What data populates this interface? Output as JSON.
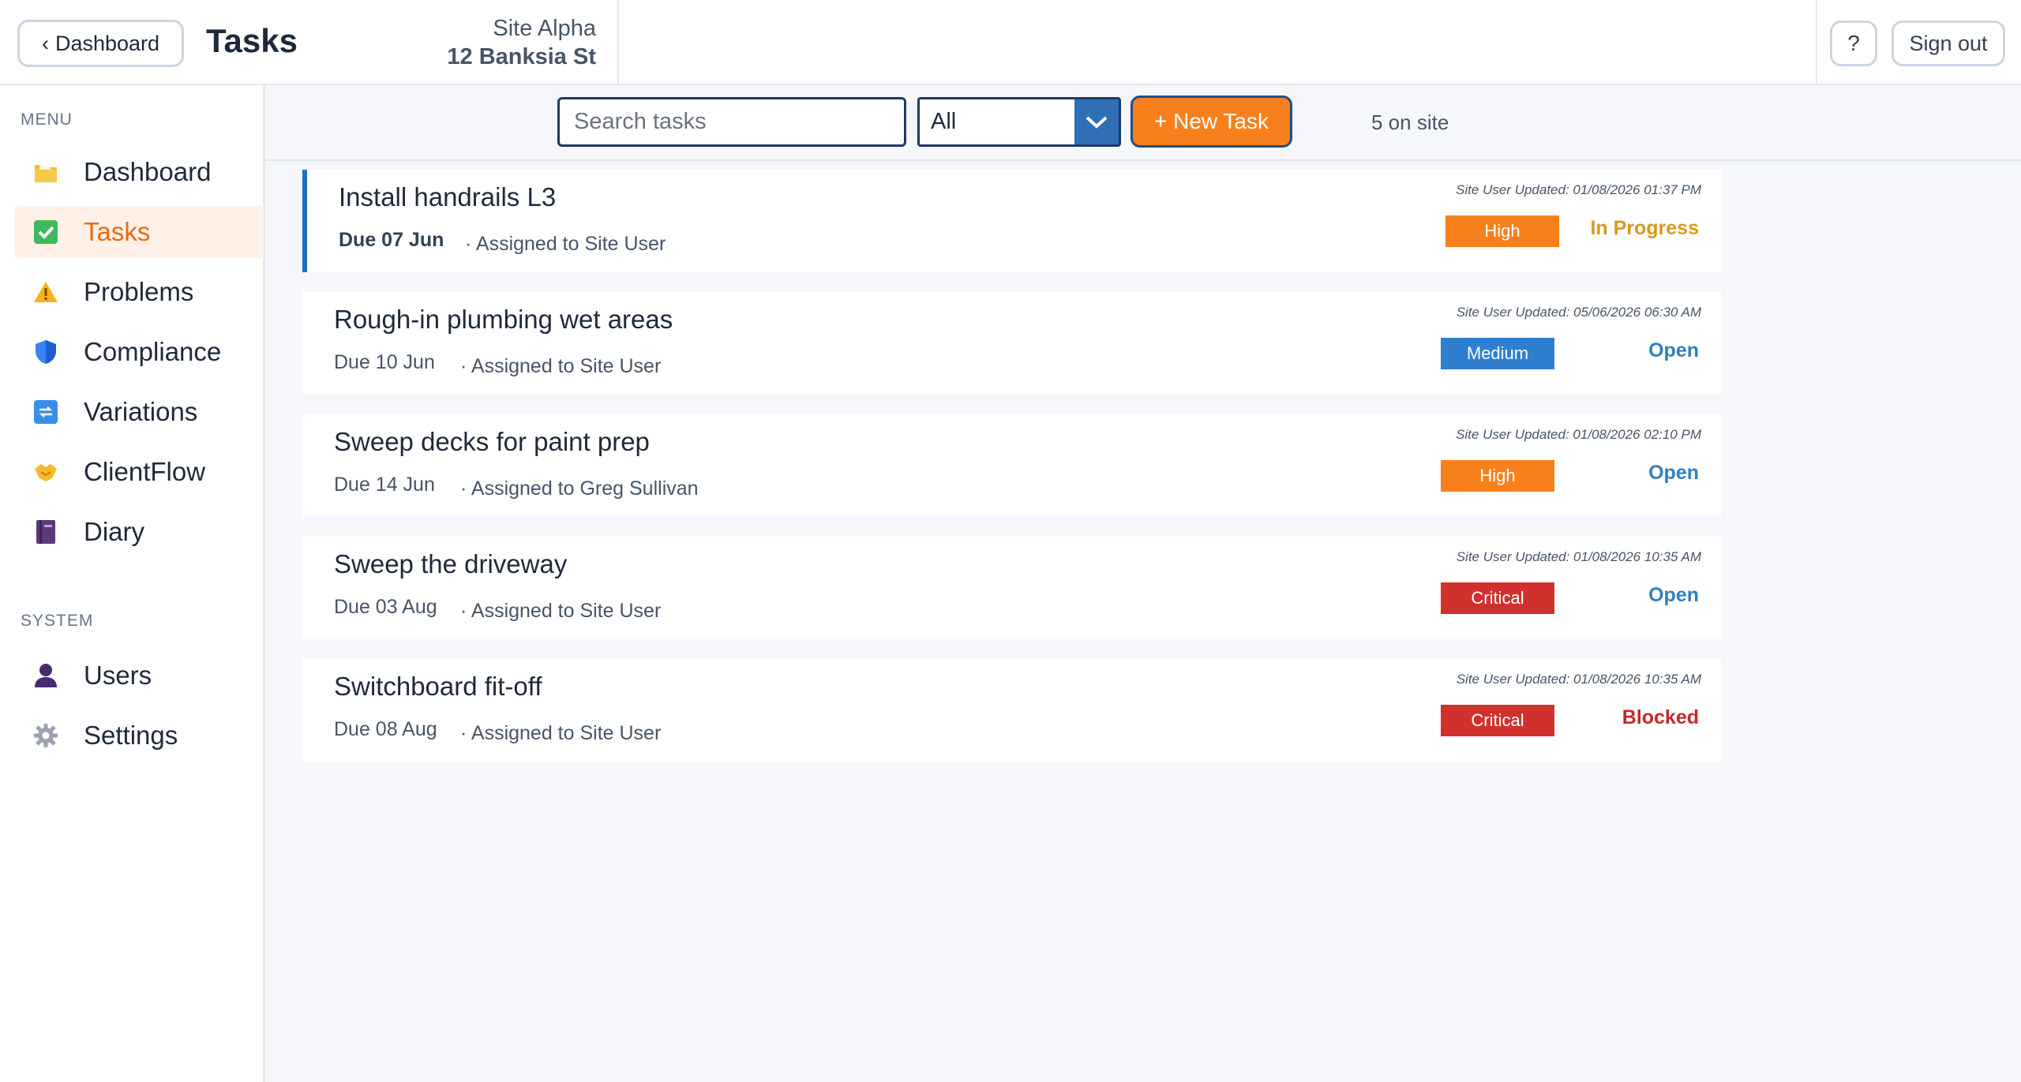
{
  "header": {
    "back_label": "Dashboard",
    "title": "Tasks",
    "site_name": "Site Alpha",
    "site_address": "12 Banksia St",
    "help_label": "?",
    "signout_label": "Sign out"
  },
  "sidebar": {
    "menu_label": "MENU",
    "system_label": "SYSTEM",
    "menu_items": [
      {
        "label": "Dashboard",
        "icon": "folder-icon"
      },
      {
        "label": "Tasks",
        "icon": "checkbox-icon",
        "active": true
      },
      {
        "label": "Problems",
        "icon": "warning-icon"
      },
      {
        "label": "Compliance",
        "icon": "shield-icon"
      },
      {
        "label": "Variations",
        "icon": "repeat-icon"
      },
      {
        "label": "ClientFlow",
        "icon": "handshake-icon"
      },
      {
        "label": "Diary",
        "icon": "book-icon"
      }
    ],
    "system_items": [
      {
        "label": "Users",
        "icon": "user-icon"
      },
      {
        "label": "Settings",
        "icon": "gear-icon"
      }
    ]
  },
  "toolbar": {
    "search_placeholder": "Search tasks",
    "filter_value": "All",
    "new_task_label": "+ New Task",
    "count_text": "5 on site"
  },
  "tasks": [
    {
      "title": "Install handrails L3",
      "due": "Due 07 Jun",
      "assigned": "· Assigned to Site User",
      "updated": "Site User Updated: 01/08/2026 01:37 PM",
      "priority": "High",
      "status": "In Progress"
    },
    {
      "title": "Rough-in plumbing wet areas",
      "due": "Due 10 Jun",
      "assigned": "· Assigned to Site User",
      "updated": "Site User Updated: 05/06/2026 06:30 AM",
      "priority": "Medium",
      "status": "Open"
    },
    {
      "title": "Sweep decks for paint prep",
      "due": "Due 14 Jun",
      "assigned": "· Assigned to Greg Sullivan",
      "updated": "Site User Updated: 01/08/2026 02:10 PM",
      "priority": "High",
      "status": "Open"
    },
    {
      "title": "Sweep the driveway",
      "due": "Due 03 Aug",
      "assigned": "· Assigned to Site User",
      "updated": "Site User Updated: 01/08/2026 10:35 AM",
      "priority": "Critical",
      "status": "Open"
    },
    {
      "title": "Switchboard fit-off",
      "due": "Due 08 Aug",
      "assigned": "· Assigned to Site User",
      "updated": "Site User Updated: 01/08/2026 10:35 AM",
      "priority": "Critical",
      "status": "Blocked"
    }
  ],
  "colors": {
    "accent": "#f7801c",
    "priority_high": "#f7801c",
    "priority_medium": "#2f7fd0",
    "priority_critical": "#d0312d",
    "status_in_progress": "#d99a1a",
    "status_open": "#2f7fc0",
    "status_blocked": "#c62828"
  }
}
